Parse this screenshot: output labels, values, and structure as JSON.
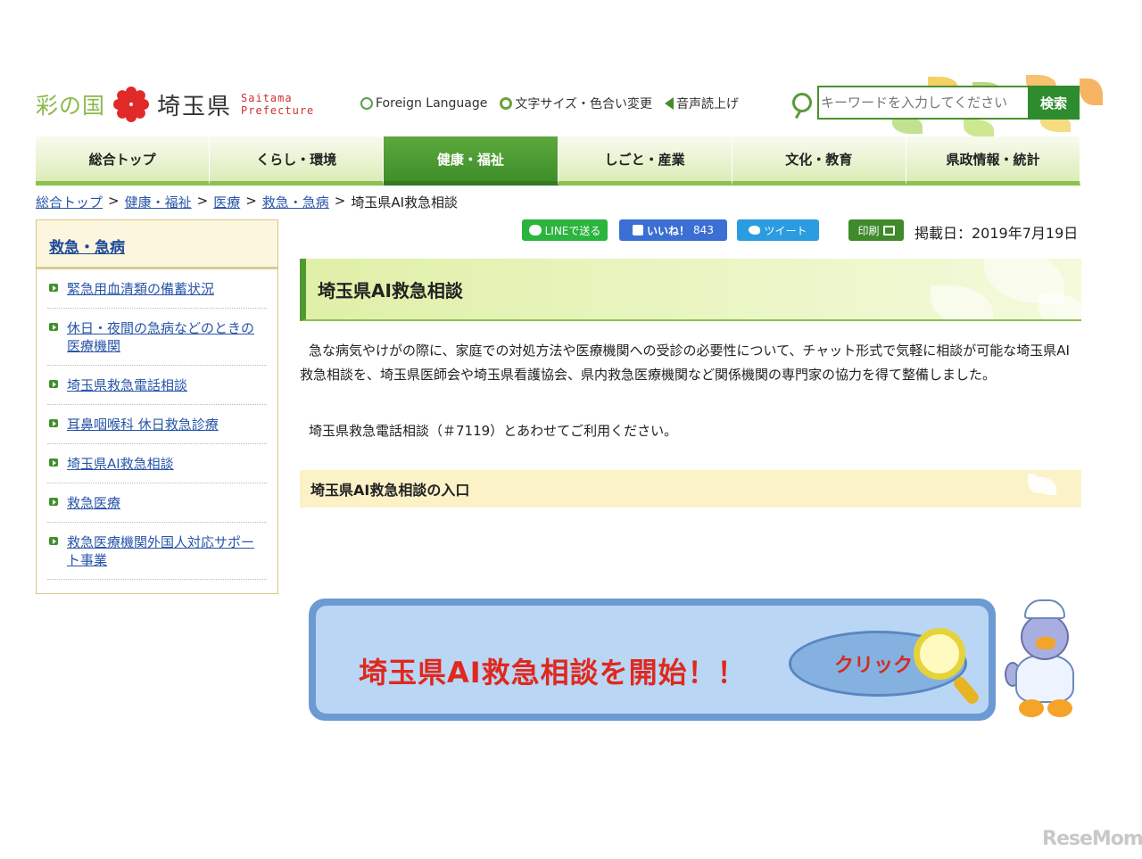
{
  "header": {
    "logo_sai": "彩の国",
    "logo_pref": "埼玉県",
    "logo_en_1": "Saitama",
    "logo_en_2": "Prefecture",
    "util": [
      {
        "icon": "globe-icon",
        "label": "Foreign Language"
      },
      {
        "icon": "gear-icon",
        "label": "文字サイズ・色合い変更"
      },
      {
        "icon": "speaker-icon",
        "label": "音声読上げ"
      }
    ],
    "search": {
      "placeholder": "キーワードを入力してください",
      "button": "検索"
    }
  },
  "nav": [
    "総合トップ",
    "くらし・環境",
    "健康・福祉",
    "しごと・産業",
    "文化・教育",
    "県政情報・統計"
  ],
  "nav_active": "健康・福祉",
  "breadcrumb": [
    "総合トップ",
    "健康・福祉",
    "医療",
    "救急・急病",
    "埼玉県AI救急相談"
  ],
  "breadcrumb_sep": ">",
  "sidebar": {
    "heading": "救急・急病",
    "items": [
      "緊急用血清類の備蓄状況",
      "休日・夜間の急病などのときの医療機関",
      "埼玉県救急電話相談",
      "耳鼻咽喉科 休日救急診療",
      "埼玉県AI救急相談",
      "救急医療",
      "救急医療機関外国人対応サポート事業"
    ]
  },
  "share": {
    "line": "LINEで送る",
    "like": "いいね！",
    "like_count": "843",
    "tweet": "ツイート",
    "print": "印刷"
  },
  "posted_date": "掲載日：2019年7月19日",
  "page_title": "埼玉県AI救急相談",
  "body_text": "急な病気やけがの際に、家庭での対処方法や医療機関への受診の必要性について、チャット形式で気軽に相談が可能な埼玉県AI救急相談を、埼玉県医師会や埼玉県看護協会、県内救急医療機関など関係機関の専門家の協力を得て整備しました。",
  "body_text_2": "埼玉県救急電話相談（＃7119）とあわせてご利用ください。",
  "entry_heading": "埼玉県AI救急相談の入口",
  "banner": {
    "text": "埼玉県AI救急相談を開始！！",
    "click": "クリック"
  },
  "watermark": "ReseMom",
  "colors": {
    "accent_green": "#3e8e2a",
    "link_blue": "#2855a8",
    "banner_red": "#e0281e"
  }
}
